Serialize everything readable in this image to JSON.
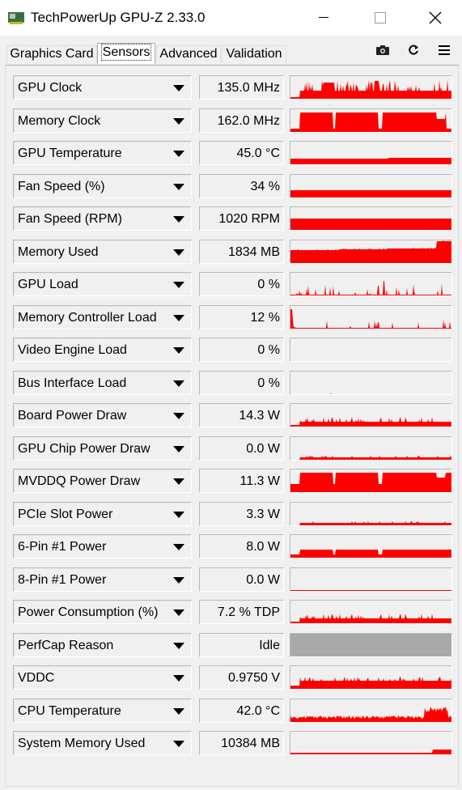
{
  "window": {
    "title": "TechPowerUp GPU-Z 2.33.0"
  },
  "tabs": [
    {
      "label": "Graphics Card",
      "active": false
    },
    {
      "label": "Sensors",
      "active": true
    },
    {
      "label": "Advanced",
      "active": false
    },
    {
      "label": "Validation",
      "active": false
    }
  ],
  "toolbar": {
    "screenshot_icon": "camera-icon",
    "refresh_icon": "refresh-icon",
    "menu_icon": "hamburger-menu-icon"
  },
  "colors": {
    "graph_line": "#ff0000",
    "graph_gray": "#a9a9a9"
  },
  "sensors": [
    {
      "label": "GPU Clock",
      "value": "135.0 MHz",
      "graph": "clock"
    },
    {
      "label": "Memory Clock",
      "value": "162.0 MHz",
      "graph": "memclock"
    },
    {
      "label": "GPU Temperature",
      "value": "45.0 °C",
      "graph": "temp"
    },
    {
      "label": "Fan Speed (%)",
      "value": "34 %",
      "graph": "flatmid"
    },
    {
      "label": "Fan Speed (RPM)",
      "value": "1020 RPM",
      "graph": "flathigh"
    },
    {
      "label": "Memory Used",
      "value": "1834 MB",
      "graph": "memused"
    },
    {
      "label": "GPU Load",
      "value": "0 %",
      "graph": "spiky"
    },
    {
      "label": "Memory Controller Load",
      "value": "12 %",
      "graph": "spiky2"
    },
    {
      "label": "Video Engine Load",
      "value": "0 %",
      "graph": "empty"
    },
    {
      "label": "Bus Interface Load",
      "value": "0 %",
      "graph": "dot"
    },
    {
      "label": "Board Power Draw",
      "value": "14.3 W",
      "graph": "power"
    },
    {
      "label": "GPU Chip Power Draw",
      "value": "0.0 W",
      "graph": "lowpower"
    },
    {
      "label": "MVDDQ Power Draw",
      "value": "11.3 W",
      "graph": "mvddq"
    },
    {
      "label": "PCIe Slot Power",
      "value": "3.3 W",
      "graph": "pcie"
    },
    {
      "label": "6-Pin #1 Power",
      "value": "8.0 W",
      "graph": "sixpin"
    },
    {
      "label": "8-Pin #1 Power",
      "value": "0.0 W",
      "graph": "eightpin"
    },
    {
      "label": "Power Consumption (%)",
      "value": "7.2 % TDP",
      "graph": "power"
    },
    {
      "label": "PerfCap Reason",
      "value": "Idle",
      "graph": "gray"
    },
    {
      "label": "VDDC",
      "value": "0.9750 V",
      "graph": "vddc"
    },
    {
      "label": "CPU Temperature",
      "value": "42.0 °C",
      "graph": "cputemp"
    },
    {
      "label": "System Memory Used",
      "value": "10384 MB",
      "graph": "sysmem"
    }
  ]
}
